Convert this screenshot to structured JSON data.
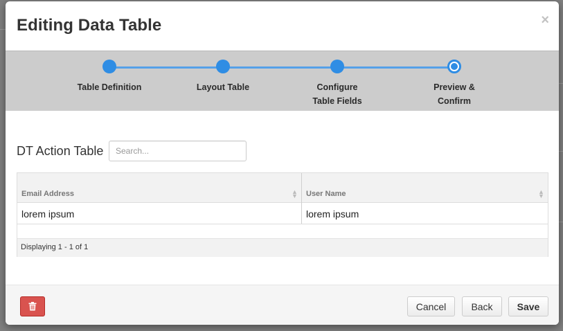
{
  "modal": {
    "title": "Editing Data Table",
    "close_glyph": "×"
  },
  "wizard": {
    "steps": [
      {
        "label": "Table Definition",
        "state": "complete"
      },
      {
        "label": "Layout Table",
        "state": "complete"
      },
      {
        "label": "Configure Table Fields",
        "state": "complete"
      },
      {
        "label": "Preview & Confirm",
        "state": "current"
      }
    ],
    "accent_color": "#2f8de4"
  },
  "table": {
    "title": "DT Action Table",
    "search_placeholder": "Search...",
    "search_value": "",
    "columns": [
      "Email Address",
      "User Name"
    ],
    "rows": [
      [
        "lorem ipsum",
        "lorem ipsum"
      ]
    ],
    "footer": "Displaying 1 - 1 of 1"
  },
  "footer": {
    "delete_icon": "trash-icon",
    "cancel_label": "Cancel",
    "back_label": "Back",
    "save_label": "Save",
    "delete_color": "#d9534f"
  }
}
